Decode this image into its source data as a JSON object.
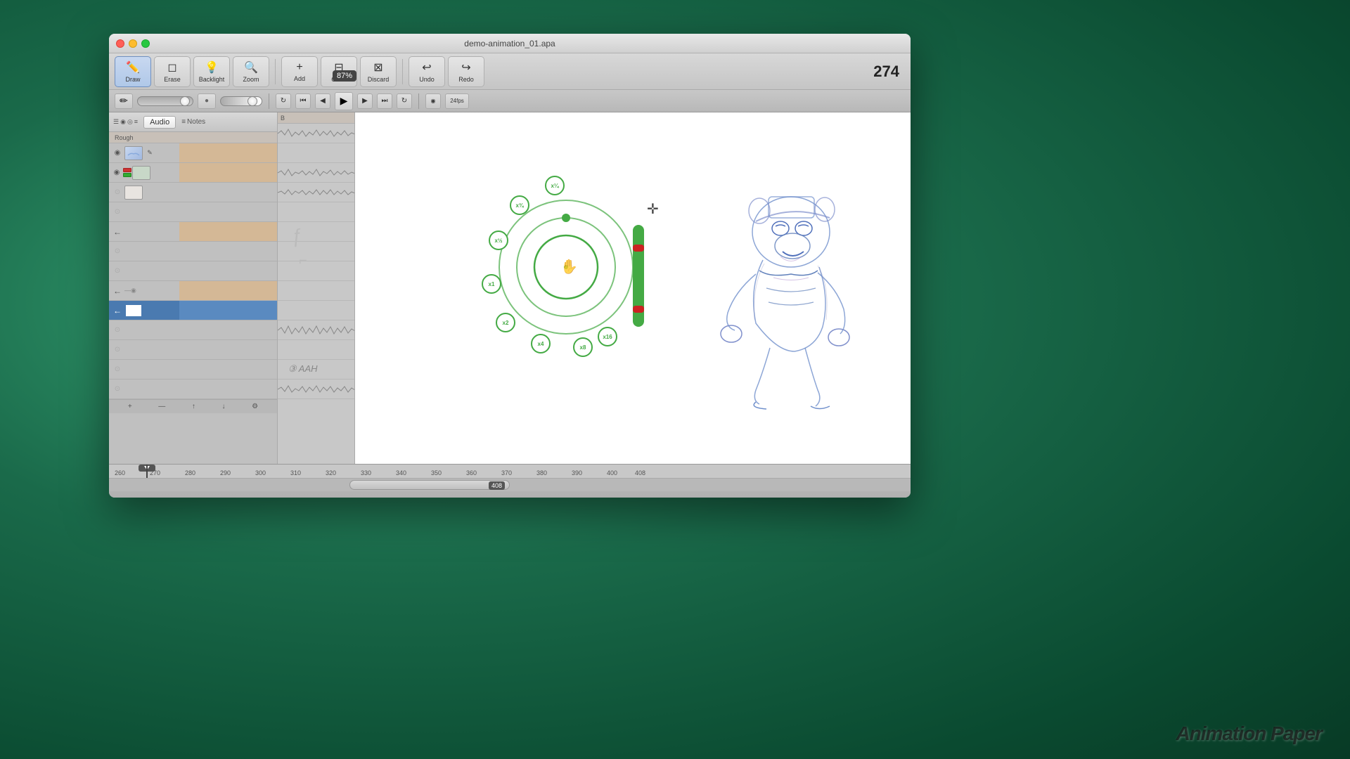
{
  "desktop": {
    "bg_color": "#2a7a5a"
  },
  "window": {
    "title": "demo-animation_01.apa",
    "frame_counter": "274",
    "zoom_label": "87%"
  },
  "toolbar": {
    "draw_label": "Draw",
    "erase_label": "Erase",
    "backlight_label": "Backlight",
    "zoom_label": "Zoom",
    "add_label": "Add",
    "clear_label": "Clear",
    "discard_label": "Discard",
    "undo_label": "Undo",
    "redo_label": "Redo"
  },
  "panels": {
    "audio_tab": "Audio",
    "notes_tab": "Notes",
    "rough_label": "Rough"
  },
  "timeline": {
    "rulers": [
      "260",
      "270",
      "280",
      "290",
      "300",
      "310",
      "320",
      "330",
      "340",
      "350",
      "360",
      "370",
      "380",
      "390",
      "400",
      "408"
    ],
    "current_frame_label": "408"
  },
  "speed_dial": {
    "options": [
      "x¼",
      "x¾",
      "x½",
      "x1",
      "x2",
      "x4",
      "x8",
      "x16"
    ],
    "center_icon": "✋"
  },
  "watermark": "Animation Paper"
}
